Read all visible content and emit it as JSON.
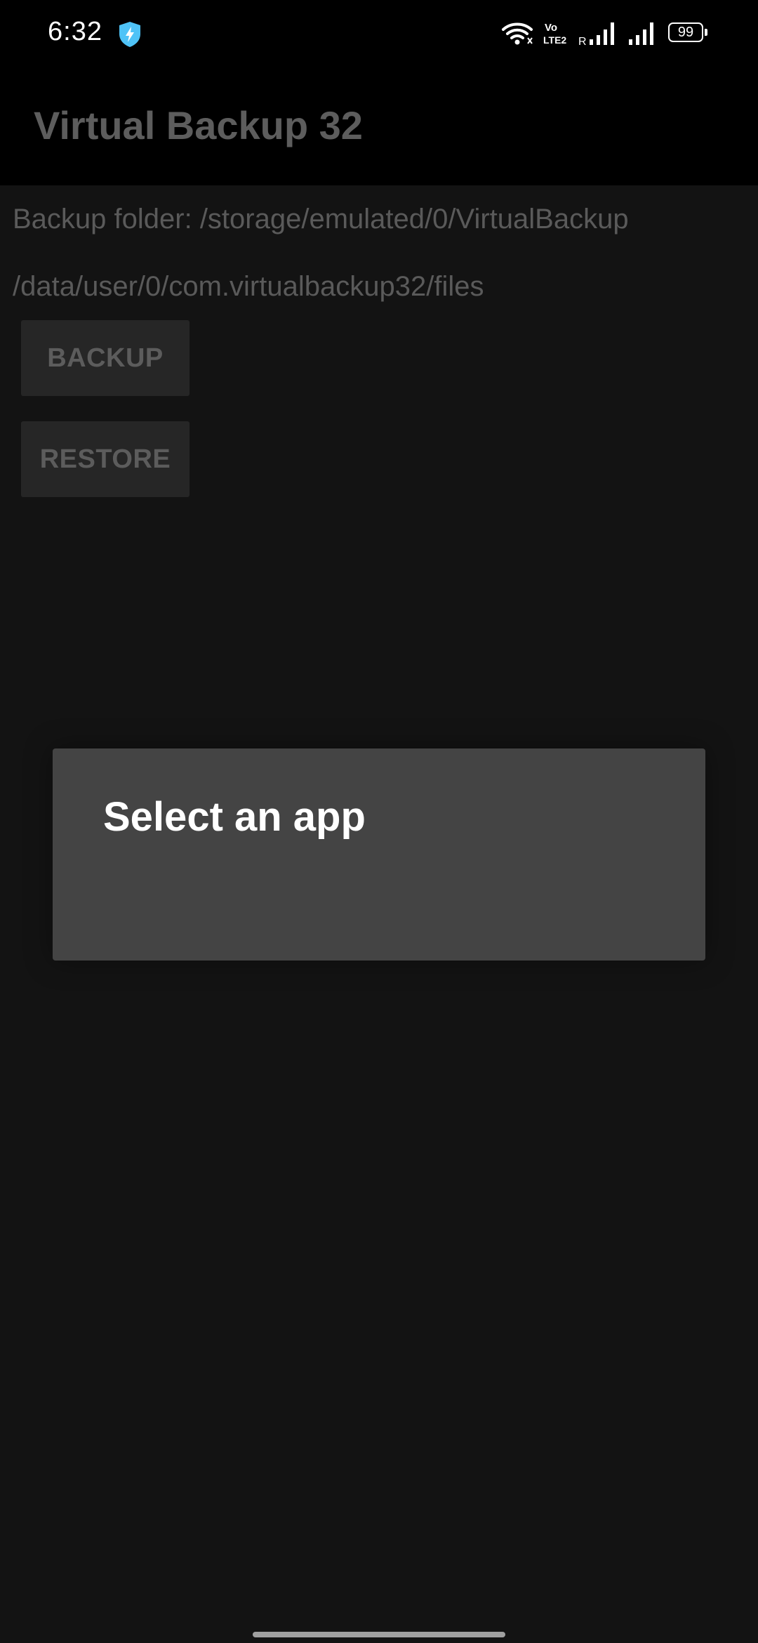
{
  "status_bar": {
    "time": "6:32",
    "battery_level": "99",
    "icons": [
      "shield-lightning-icon",
      "wifi-icon",
      "volte-lte2-icon",
      "signal-r-icon",
      "signal-icon",
      "battery-icon"
    ]
  },
  "app_bar": {
    "title": "Virtual Backup 32"
  },
  "content": {
    "backup_folder_text": "Backup folder: /storage/emulated/0/VirtualBackup",
    "files_path_text": "/data/user/0/com.virtualbackup32/files",
    "backup_button_label": "BACKUP",
    "restore_button_label": "RESTORE"
  },
  "dialog": {
    "title": "Select an app"
  },
  "colors": {
    "background": "#131313",
    "app_bar": "#000000",
    "dialog": "#444444",
    "shield_accent": "#4fc3f7"
  }
}
